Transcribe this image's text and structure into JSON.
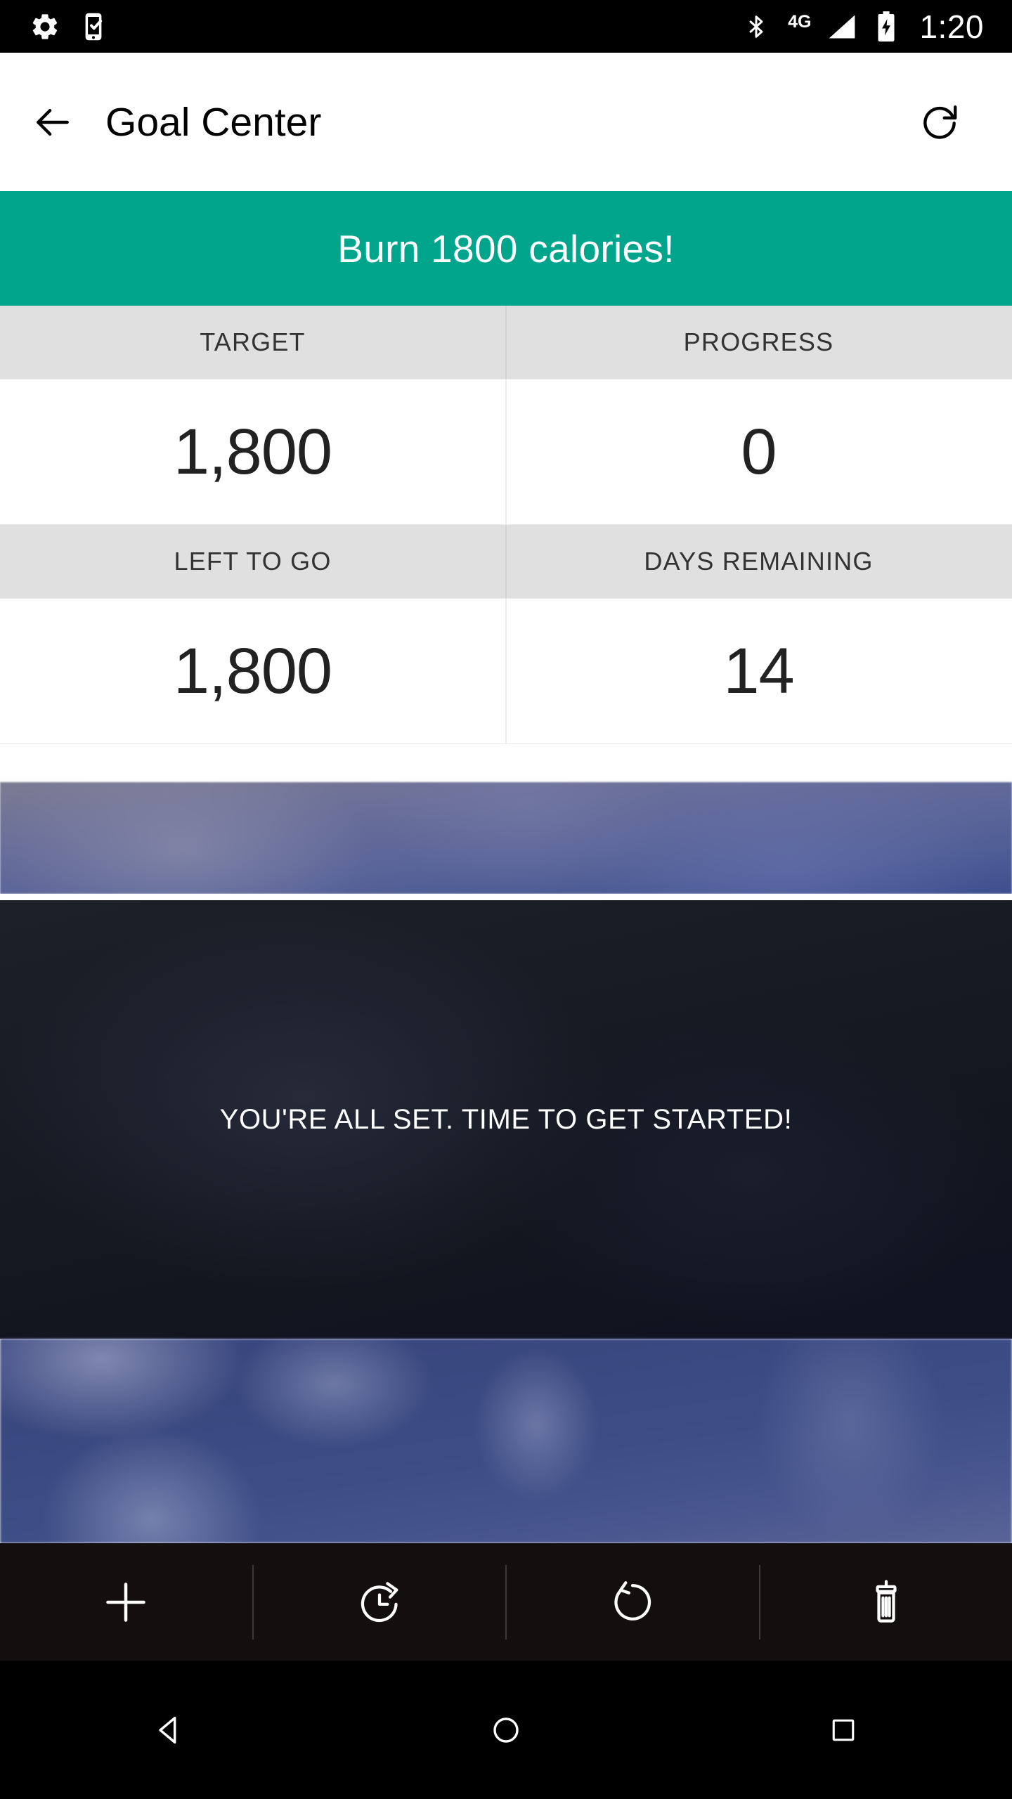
{
  "status_bar": {
    "left_icons": [
      {
        "name": "settings-gear-icon",
        "label": "settings"
      },
      {
        "name": "phone-check-icon",
        "label": "device-check"
      }
    ],
    "right_icons": [
      {
        "name": "bluetooth-icon",
        "label": "bluetooth"
      },
      {
        "name": "signal-icon",
        "label": "signal"
      },
      {
        "name": "battery-charging-icon",
        "label": "battery charging"
      }
    ],
    "network_label": "4G",
    "time": "1:20"
  },
  "app_bar": {
    "back_label": "Back",
    "title": "Goal Center",
    "refresh_label": "Refresh"
  },
  "banner": {
    "text": "Burn 1800 calories!",
    "color": "#00a58c"
  },
  "stats": {
    "headers_row1": [
      "TARGET",
      "PROGRESS"
    ],
    "values_row1": [
      "1,800",
      "0"
    ],
    "headers_row2": [
      "LEFT TO GO",
      "DAYS REMAINING"
    ],
    "values_row2": [
      "1,800",
      "14"
    ]
  },
  "hero": {
    "message": "YOU'RE ALL SET. TIME TO GET STARTED!"
  },
  "action_bar": {
    "items": [
      {
        "name": "add-button",
        "icon": "plus-icon",
        "label": "Add"
      },
      {
        "name": "history-button",
        "icon": "clock-arrow-icon",
        "label": "History"
      },
      {
        "name": "reset-button",
        "icon": "rotate-icon",
        "label": "Reset"
      },
      {
        "name": "delete-button",
        "icon": "trash-icon",
        "label": "Delete"
      }
    ]
  },
  "nav_bar": {
    "items": [
      {
        "name": "nav-back",
        "icon": "triangle-back-icon",
        "label": "Back"
      },
      {
        "name": "nav-home",
        "icon": "circle-home-icon",
        "label": "Home"
      },
      {
        "name": "nav-recents",
        "icon": "square-recents-icon",
        "label": "Recents"
      }
    ]
  }
}
